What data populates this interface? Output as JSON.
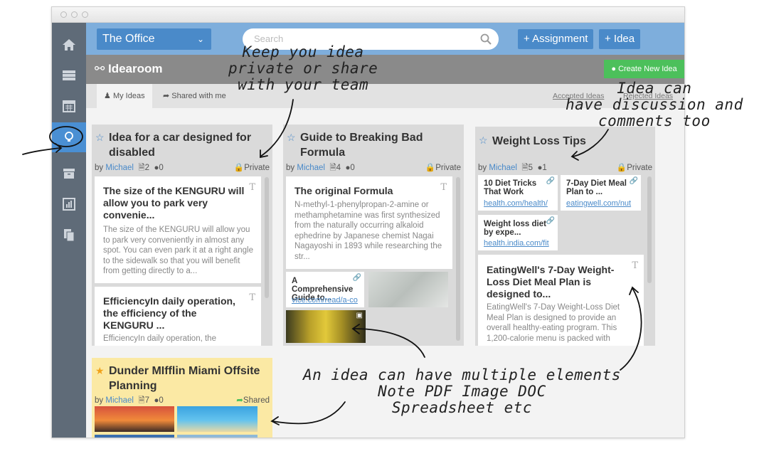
{
  "topbar": {
    "office_label": "The Office",
    "search_placeholder": "Search",
    "assignment_label": "+ Assignment",
    "idea_label": "+ Idea"
  },
  "subbar": {
    "title": "Idearoom",
    "create_label": "Create New Idea"
  },
  "tabs": {
    "my_ideas": "My Ideas",
    "shared": "Shared with me",
    "accepted": "Accepted Ideas",
    "rejected": "Rejected Ideas"
  },
  "cards": [
    {
      "title": "Idea for a car designed for disabled",
      "author_prefix": "by",
      "author": "Michael",
      "docs": "2",
      "comments": "0",
      "status": "Private",
      "notes": [
        {
          "title": "The size of the KENGURU will allow you to park very convenie...",
          "body": "The size of the KENGURU will allow you to park very conveniently in almost any spot. You can even park it at a right angle to the sidewalk so that you will benefit from getting directly to a..."
        },
        {
          "title": "EfficiencyIn daily operation, the efficiency of the KENGURU ...",
          "body": "EfficiencyIn daily operation, the"
        }
      ]
    },
    {
      "title": "Guide to Breaking Bad Formula",
      "author_prefix": "by",
      "author": "Michael",
      "docs": "4",
      "comments": "0",
      "status": "Private",
      "notes": [
        {
          "title": "The original Formula",
          "body": "N-methyl-1-phenylpropan-2-amine or methamphetamine was first synthesized from the naturally occurring alkaloid ephedrine by Japanese chemist Nagai Nagayoshi in 1893 while researching the str..."
        }
      ],
      "link": {
        "title": "A Comprehensive Guide to...",
        "url": "vice.com/read/a-co"
      }
    },
    {
      "title": "Weight Loss Tips",
      "author_prefix": "by",
      "author": "Michael",
      "docs": "5",
      "comments": "1",
      "status": "Private",
      "links": [
        {
          "title": "10 Diet Tricks That Work",
          "url": "health.com/health/"
        },
        {
          "title": "7-Day Diet Meal Plan to ...",
          "url": "eatingwell.com/nut"
        },
        {
          "title": "Weight loss diet by expe...",
          "url": "health.india.com/fit"
        }
      ],
      "notes": [
        {
          "title": "EatingWell's 7-Day Weight-Loss Diet Meal Plan is designed to...",
          "body": "EatingWell's 7-Day Weight-Loss Diet Meal Plan is designed to provide an overall healthy-eating program. This 1,200-calorie menu is packed with"
        }
      ]
    },
    {
      "title": "Dunder MIfflin Miami Offsite Planning",
      "author_prefix": "by",
      "author": "Michael",
      "docs": "7",
      "comments": "0",
      "status": "Shared"
    }
  ],
  "annotations": {
    "privacy": "Keep you idea\nprivate or share\nwith your team",
    "discussion": "Idea can\nhave discussion and\ncomments too",
    "elements": "An idea can have multiple elements\nNote PDF Image DOC\nSpreadsheet etc"
  },
  "colors": {
    "sidebar": "#5f6b78",
    "accent_blue": "#4a8ac9",
    "topbar": "#7eaedc",
    "create_green": "#4cc05b",
    "shared_card": "#fbe9a4",
    "private_red": "#e04848"
  }
}
